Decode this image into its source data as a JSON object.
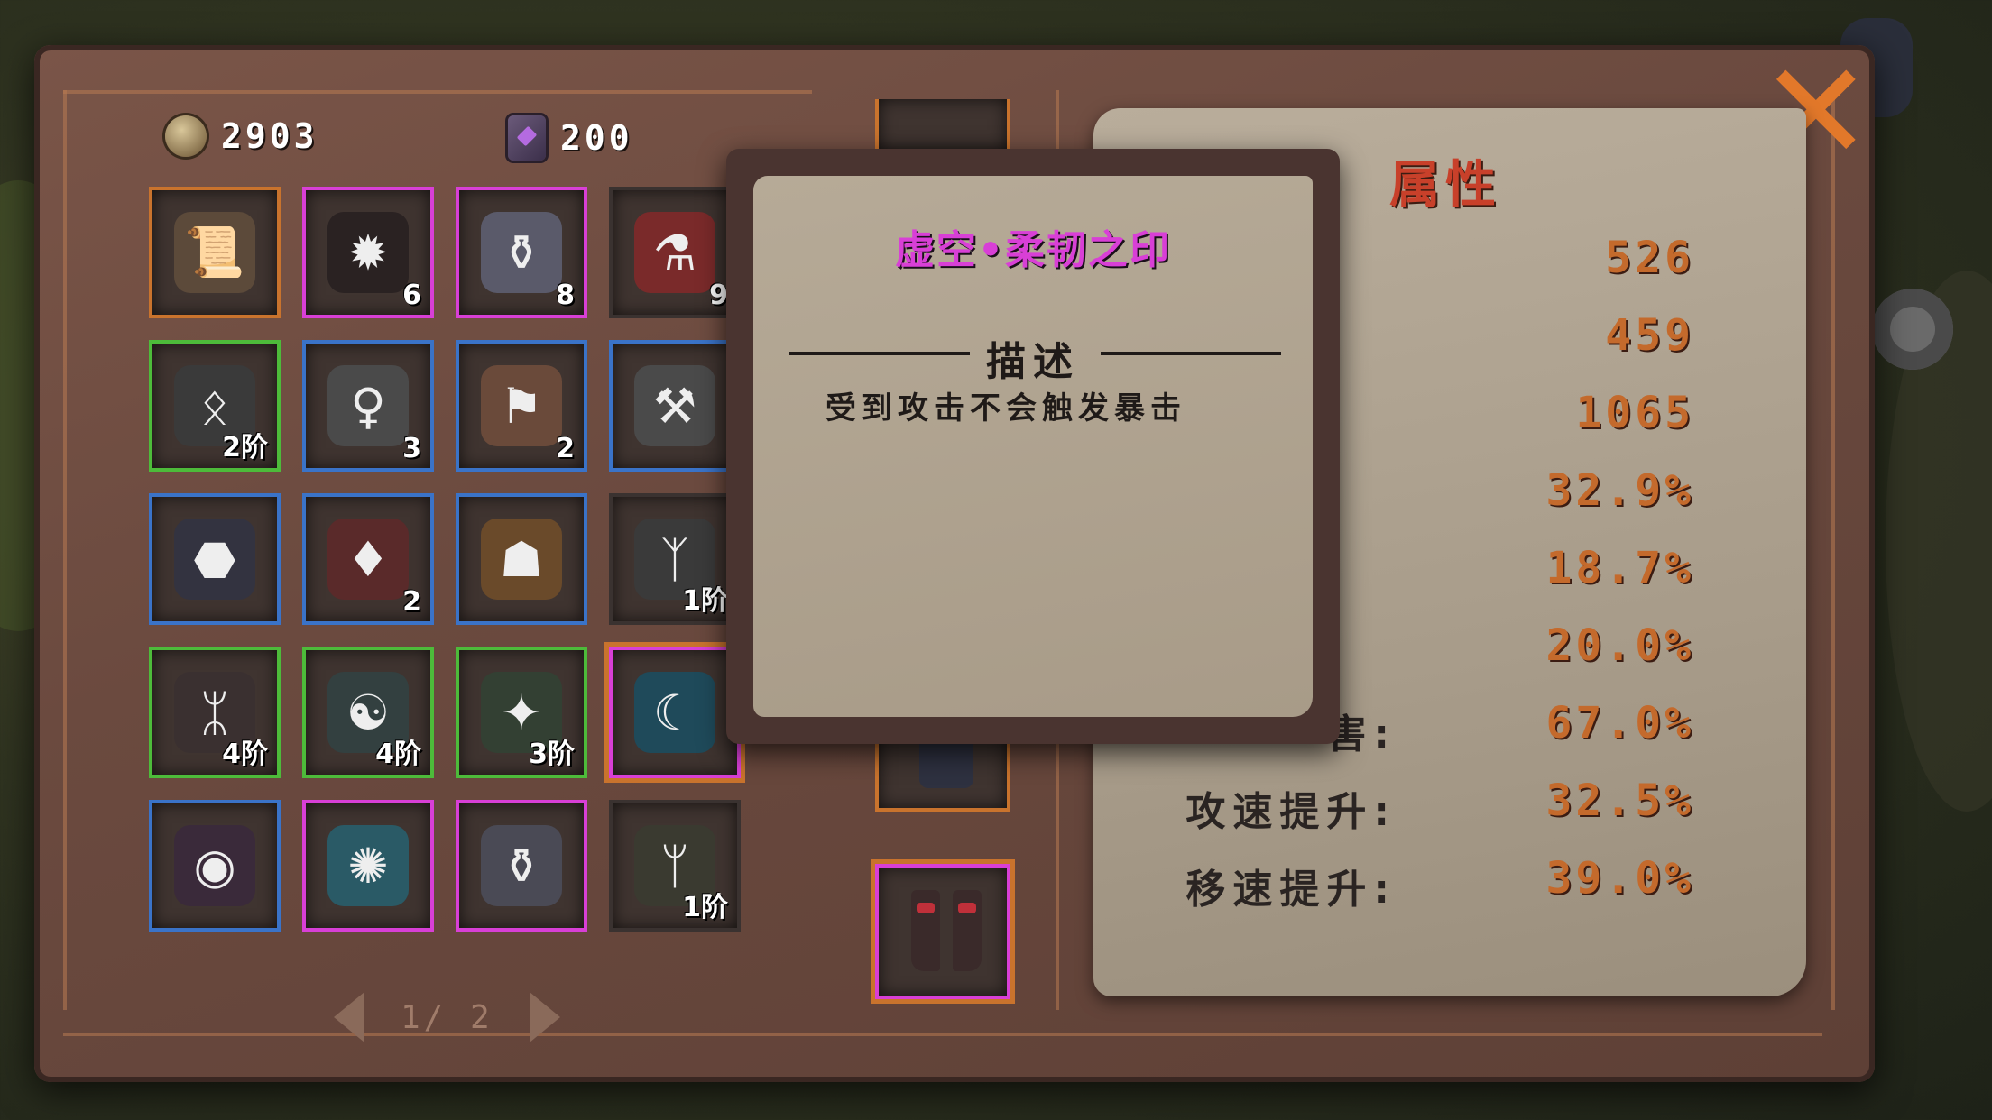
{
  "currency": {
    "gold": "2903",
    "gems": "200"
  },
  "inventory": {
    "slots": [
      {
        "name": "cloth-scroll",
        "quality": "orange",
        "glyph": "📜",
        "bg": "#5c4a3a",
        "count": ""
      },
      {
        "name": "dark-crystal",
        "quality": "purple",
        "glyph": "✹",
        "bg": "#2a2222",
        "count": "6"
      },
      {
        "name": "seed-jar",
        "quality": "purple",
        "glyph": "⚱",
        "bg": "#5a5a6a",
        "count": "8"
      },
      {
        "name": "red-potion",
        "quality": "dark",
        "glyph": "⚗",
        "bg": "#7a2a2a",
        "count": "9"
      },
      {
        "name": "rune-stone",
        "quality": "green",
        "glyph": "ᛟ",
        "bg": "#3a3a3a",
        "count": "2阶"
      },
      {
        "name": "statue",
        "quality": "blue",
        "glyph": "♀",
        "bg": "#4a4a4a",
        "count": "3"
      },
      {
        "name": "tattered-banner",
        "quality": "blue",
        "glyph": "⚑",
        "bg": "#6a4a3a",
        "count": "2"
      },
      {
        "name": "hammer",
        "quality": "blue",
        "glyph": "⚒",
        "bg": "#4a4a4a",
        "count": ""
      },
      {
        "name": "ore-rock",
        "quality": "blue",
        "glyph": "⬣",
        "bg": "#333340",
        "count": ""
      },
      {
        "name": "red-shard",
        "quality": "blue",
        "glyph": "♦",
        "bg": "#5a2a2a",
        "count": "2"
      },
      {
        "name": "beast-head",
        "quality": "blue",
        "glyph": "☗",
        "bg": "#6a4a2a",
        "count": ""
      },
      {
        "name": "orange-rune",
        "quality": "dark",
        "glyph": "ᛉ",
        "bg": "#3a3a3a",
        "count": "1阶"
      },
      {
        "name": "fire-rune",
        "quality": "green",
        "glyph": "ᛯ",
        "bg": "#3a3030",
        "count": "4阶"
      },
      {
        "name": "cat-rune",
        "quality": "green",
        "glyph": "☯",
        "bg": "#334040",
        "count": "4阶"
      },
      {
        "name": "leaf-rune",
        "quality": "green",
        "glyph": "✦",
        "bg": "#334033",
        "count": "3阶"
      },
      {
        "name": "void-seal",
        "quality": "selected",
        "glyph": "☾",
        "bg": "#1f4a5a",
        "count": ""
      },
      {
        "name": "shadow-eye",
        "quality": "blue",
        "glyph": "◉",
        "bg": "#3a2a3a",
        "count": ""
      },
      {
        "name": "frost-burst",
        "quality": "purple",
        "glyph": "✺",
        "bg": "#2a5a66",
        "count": ""
      },
      {
        "name": "empty-jar",
        "quality": "purple",
        "glyph": "⚱",
        "bg": "#4a4a55",
        "count": ""
      },
      {
        "name": "tree-rune",
        "quality": "dark",
        "glyph": "ᛘ",
        "bg": "#3a3a30",
        "count": "1阶"
      }
    ]
  },
  "pager": {
    "label": "1/ 2"
  },
  "attributes": {
    "title": "属性",
    "rows": [
      {
        "label": "",
        "value": "526"
      },
      {
        "label": "",
        "value": "459"
      },
      {
        "label": "",
        "value": "1065"
      },
      {
        "label": "",
        "value": "32.9%"
      },
      {
        "label": "",
        "value": "18.7%"
      },
      {
        "label": "",
        "value": "20.0%"
      },
      {
        "label": "害:",
        "value": "67.0%"
      },
      {
        "label": "攻速提升:",
        "value": "32.5%"
      },
      {
        "label": "移速提升:",
        "value": "39.0%"
      }
    ]
  },
  "tooltip": {
    "item_name": "虚空•柔韧之印",
    "heading": "描述",
    "description": "受到攻击不会触发暴击"
  },
  "colors": {
    "quality_orange": "#c9732d",
    "quality_purple": "#d83fd6",
    "quality_green": "#4dbb3a",
    "quality_blue": "#3a73c8",
    "attr_value": "#c46a2c",
    "attr_title": "#c8402a"
  }
}
